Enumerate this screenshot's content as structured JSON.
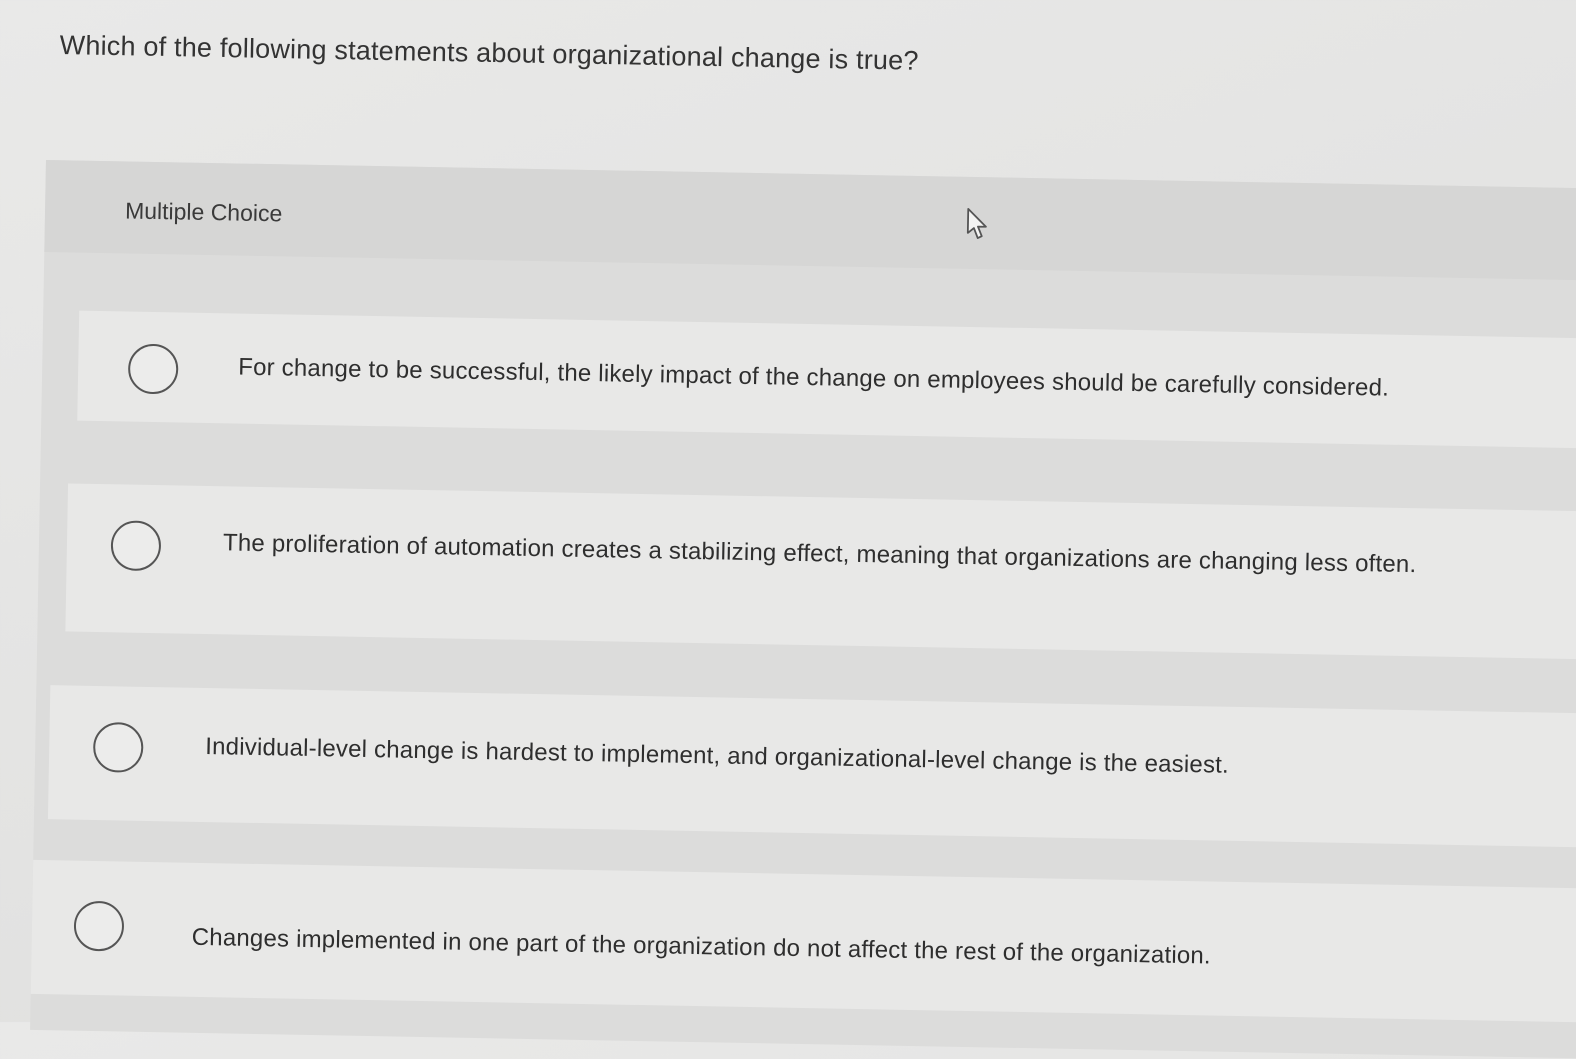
{
  "question": {
    "text": "Which of the following statements about organizational change is true?"
  },
  "multiple_choice": {
    "label": "Multiple Choice",
    "cursor": "pointer-arrow-icon",
    "options": [
      {
        "text": "For change to be successful, the likely impact of the change on employees should be carefully considered.",
        "selected": false
      },
      {
        "text": "The proliferation of automation creates a stabilizing effect, meaning that organizations are changing less often.",
        "selected": false
      },
      {
        "text": "Individual-level change is hardest to implement, and organizational-level change is the easiest.",
        "selected": false
      },
      {
        "text": "Changes implemented in one part of the organization do not affect the rest of the organization.",
        "selected": false
      }
    ]
  }
}
